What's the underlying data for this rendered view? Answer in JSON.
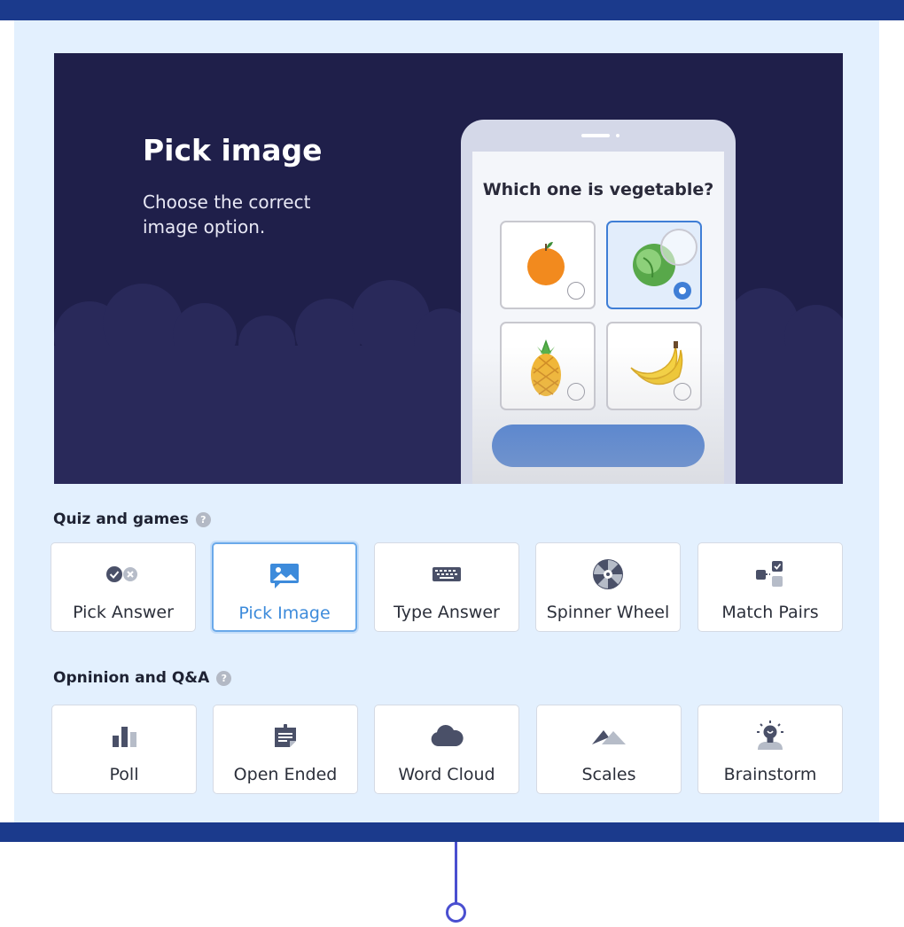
{
  "preview": {
    "title": "Pick image",
    "description": "Choose the correct image option.",
    "phone": {
      "question": "Which one is vegetable?",
      "options": [
        {
          "icon": "orange-icon",
          "selected": false
        },
        {
          "icon": "cabbage-icon",
          "selected": true
        },
        {
          "icon": "pineapple-icon",
          "selected": false
        },
        {
          "icon": "banana-icon",
          "selected": false
        }
      ]
    }
  },
  "sections": [
    {
      "title": "Quiz and games",
      "items": [
        {
          "label": "Pick Answer",
          "icon": "check-cross-icon",
          "active": false
        },
        {
          "label": "Pick Image",
          "icon": "image-icon",
          "active": true
        },
        {
          "label": "Type Answer",
          "icon": "keyboard-icon",
          "active": false
        },
        {
          "label": "Spinner Wheel",
          "icon": "spinner-wheel-icon",
          "active": false
        },
        {
          "label": "Match Pairs",
          "icon": "match-pairs-icon",
          "active": false
        }
      ]
    },
    {
      "title": "Opninion and Q&A",
      "items": [
        {
          "label": "Poll",
          "icon": "bar-chart-icon",
          "active": false
        },
        {
          "label": "Open Ended",
          "icon": "open-ended-note-icon",
          "active": false
        },
        {
          "label": "Word Cloud",
          "icon": "cloud-icon",
          "active": false
        },
        {
          "label": "Scales",
          "icon": "mountain-icon",
          "active": false
        },
        {
          "label": "Brainstorm",
          "icon": "lightbulb-icon",
          "active": false
        }
      ]
    }
  ],
  "colors": {
    "header_bar": "#1b3a8c",
    "panel_bg": "#e3f0fe",
    "preview_bg": "#1f1f4a",
    "accent": "#3d8bdb",
    "icon_gray": "#4a5068"
  }
}
